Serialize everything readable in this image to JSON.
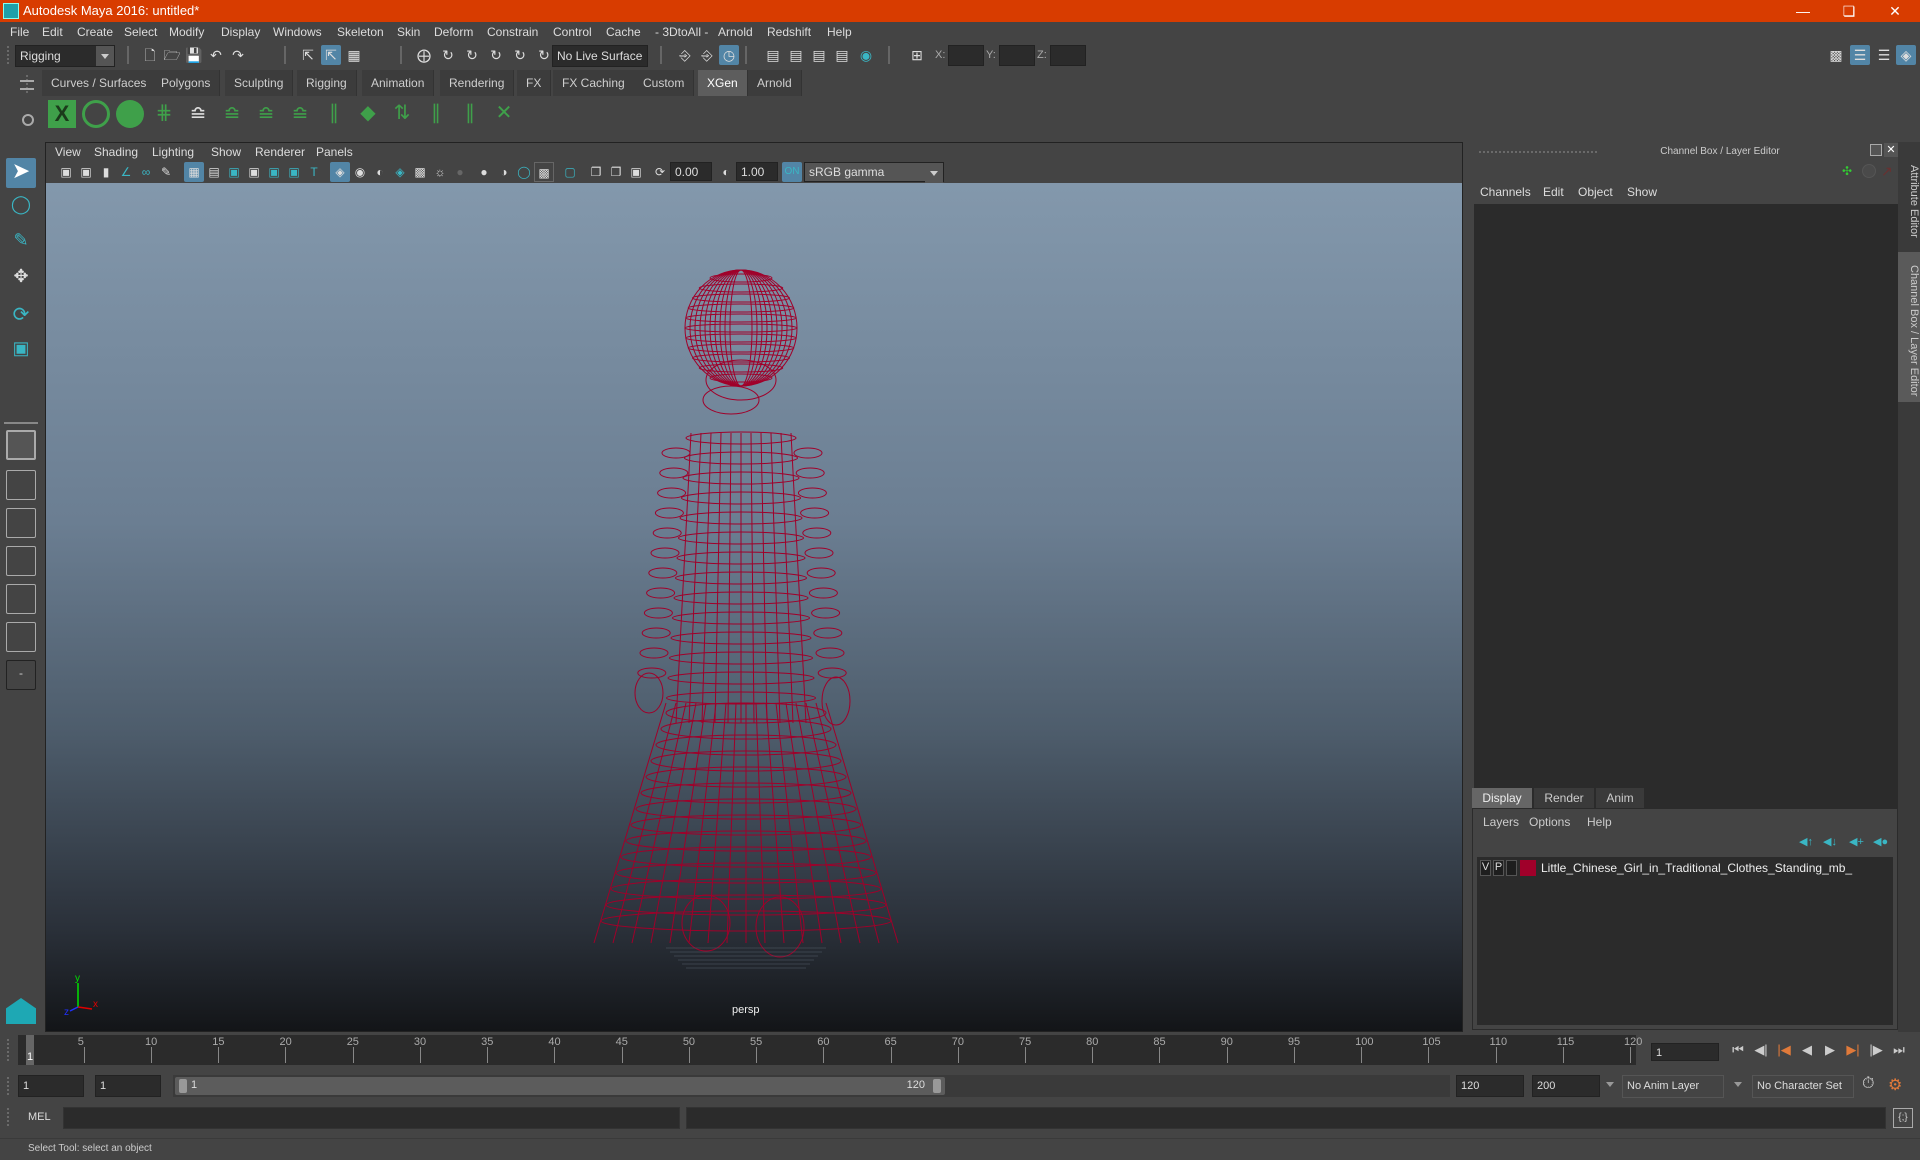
{
  "window": {
    "title": "Autodesk Maya 2016: untitled*",
    "controls": [
      "minimize",
      "restore",
      "close"
    ]
  },
  "menubar": [
    "File",
    "Edit",
    "Create",
    "Select",
    "Modify",
    "Display",
    "Windows",
    "Skeleton",
    "Skin",
    "Deform",
    "Constrain",
    "Control",
    "Cache",
    "- 3DtoAll -",
    "Arnold",
    "Redshift",
    "Help"
  ],
  "statusline": {
    "menuset": "Rigging",
    "live_surface": "No Live Surface",
    "x_label": "X:",
    "y_label": "Y:",
    "z_label": "Z:",
    "x_value": "",
    "y_value": "",
    "z_value": ""
  },
  "shelf": {
    "tabs": [
      "Curves / Surfaces",
      "Polygons",
      "Sculpting",
      "Rigging",
      "Animation",
      "Rendering",
      "FX",
      "FX Caching",
      "Custom",
      "XGen",
      "Arnold"
    ],
    "active_tab": "XGen",
    "icons": [
      "xgen-editor",
      "xgen-visibility",
      "xgen-hide",
      "create-guides",
      "add-guide",
      "sculpt-guide",
      "select-guides",
      "toggle-guide",
      "lock-guide",
      "guide-tangent",
      "flip-guides",
      "normalize-guides",
      "guides-to-curves",
      "convert-guides",
      "rebuild-guides"
    ]
  },
  "viewport": {
    "menu": [
      "View",
      "Shading",
      "Lighting",
      "Show",
      "Renderer",
      "Panels"
    ],
    "exposure": "0.00",
    "gamma": "1.00",
    "color_space": "sRGB gamma",
    "camera_label": "persp",
    "axis": {
      "x": "x",
      "y": "y",
      "z": "z"
    },
    "wireframe_color": "#a0002a"
  },
  "channel_box": {
    "title": "Channel Box / Layer Editor",
    "menu": [
      "Channels",
      "Edit",
      "Object",
      "Show"
    ]
  },
  "layer_editor": {
    "tabs": [
      "Display",
      "Render",
      "Anim"
    ],
    "active_tab": "Display",
    "menu": [
      "Layers",
      "Options",
      "Help"
    ],
    "layers": [
      {
        "visible": "V",
        "playback": "P",
        "color": "#a0002a",
        "name": "Little_Chinese_Girl_in_Traditional_Clothes_Standing_mb_"
      }
    ]
  },
  "side_tabs": [
    "Attribute Editor",
    "Channel Box / Layer Editor"
  ],
  "timeline": {
    "start": 1,
    "end": 120,
    "current_frame": "1",
    "current_marker": "1",
    "ticks": [
      5,
      10,
      15,
      20,
      25,
      30,
      35,
      40,
      45,
      50,
      55,
      60,
      65,
      70,
      75,
      80,
      85,
      90,
      95,
      100,
      105,
      110,
      115,
      120
    ]
  },
  "range": {
    "start_time": "1",
    "playback_start": "1",
    "slider_start": "1",
    "slider_end": "120",
    "playback_end": "120",
    "end_time": "200",
    "anim_layer": "No Anim Layer",
    "character_set": "No Character Set"
  },
  "command_line": {
    "language": "MEL",
    "input": "",
    "output": ""
  },
  "help_line": "Select Tool: select an object"
}
